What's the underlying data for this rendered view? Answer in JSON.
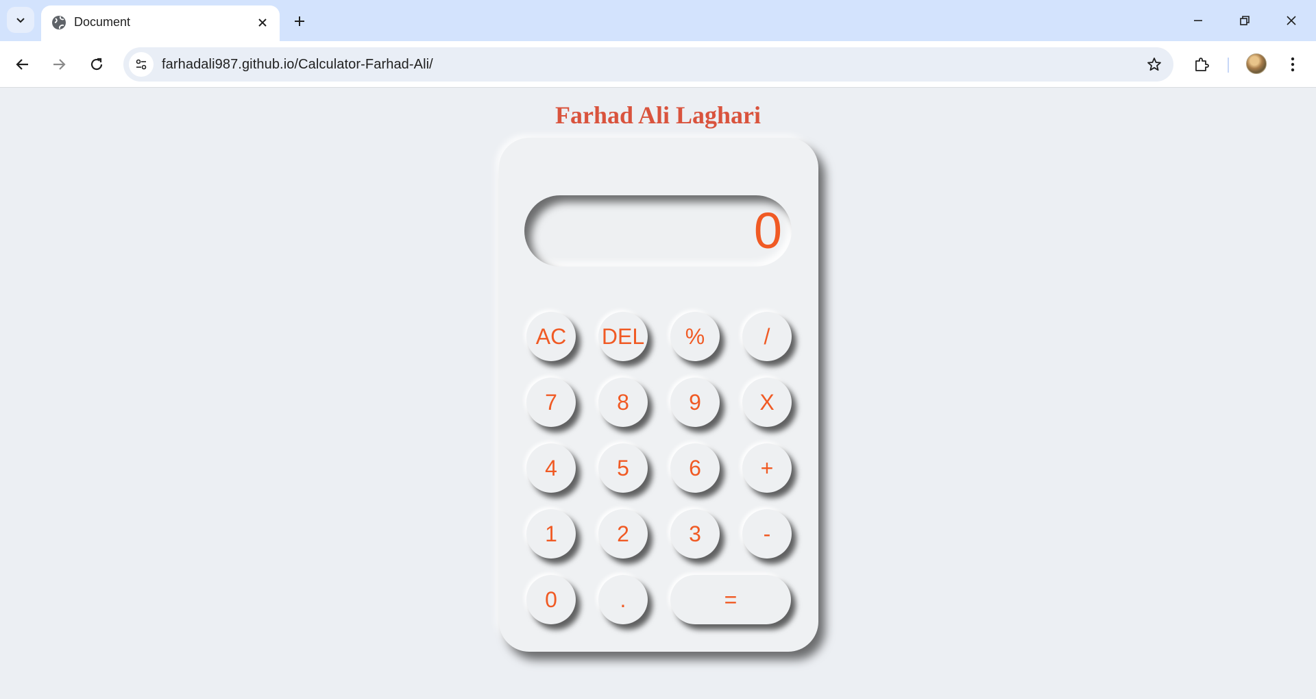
{
  "browser": {
    "tab_title": "Document",
    "url": "farhadali987.github.io/Calculator-Farhad-Ali/"
  },
  "page": {
    "heading": "Farhad Ali Laghari",
    "display_value": "0",
    "keys": {
      "ac": "AC",
      "del": "DEL",
      "percent": "%",
      "divide": "/",
      "seven": "7",
      "eight": "8",
      "nine": "9",
      "multiply": "X",
      "four": "4",
      "five": "5",
      "six": "6",
      "plus": "+",
      "one": "1",
      "two": "2",
      "three": "3",
      "minus": "-",
      "zero": "0",
      "dot": ".",
      "equals": "="
    }
  },
  "colors": {
    "accent": "#f05a24",
    "heading": "#d9533d",
    "background": "#eceff3"
  },
  "icons": [
    "tab-search-icon",
    "globe-icon",
    "close-icon",
    "plus-icon",
    "minimize-icon",
    "restore-icon",
    "back-icon",
    "forward-icon",
    "reload-icon",
    "site-info-icon",
    "star-icon",
    "extensions-icon",
    "more-icon"
  ]
}
